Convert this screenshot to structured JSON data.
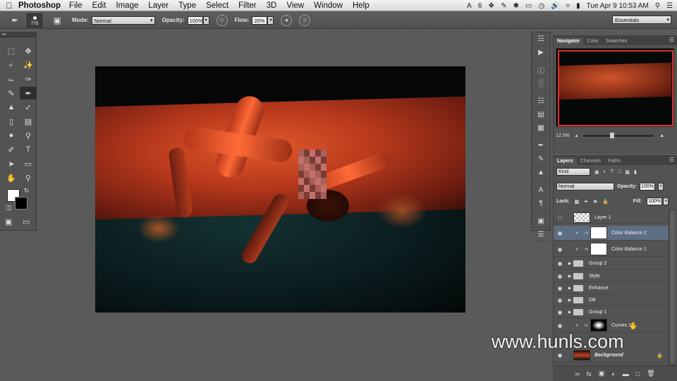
{
  "menubar": {
    "app_name": "Photoshop",
    "items": [
      "File",
      "Edit",
      "Image",
      "Layer",
      "Type",
      "Select",
      "Filter",
      "3D",
      "View",
      "Window",
      "Help"
    ],
    "tray_badge": "6",
    "clock": "Tue Apr 9  10:53 AM"
  },
  "options": {
    "brush_size": "775",
    "mode_label": "Mode:",
    "mode_value": "Normal",
    "opacity_label": "Opacity:",
    "opacity_value": "100%",
    "flow_label": "Flow:",
    "flow_value": "20%",
    "workspace": "Essentials"
  },
  "navigator": {
    "tabs": [
      "Navigator",
      "Color",
      "Swatches"
    ],
    "zoom": "12.5%"
  },
  "layers_panel": {
    "tabs": [
      "Layers",
      "Channels",
      "Paths"
    ],
    "filter_kind": "Kind",
    "blend_mode": "Normal",
    "opacity_label": "Opacity:",
    "opacity_value": "100%",
    "lock_label": "Lock:",
    "fill_label": "Fill:",
    "fill_value": "100%",
    "layers": [
      {
        "name": "Layer 1"
      },
      {
        "name": "Color Balance 2"
      },
      {
        "name": "Color Balance 1"
      },
      {
        "name": "Group 2"
      },
      {
        "name": "Style"
      },
      {
        "name": "Enhance"
      },
      {
        "name": "DB"
      },
      {
        "name": "Group 1"
      },
      {
        "name": "Curves 1"
      },
      {
        "name": "Background"
      }
    ]
  },
  "watermark": "www.hunls.com"
}
